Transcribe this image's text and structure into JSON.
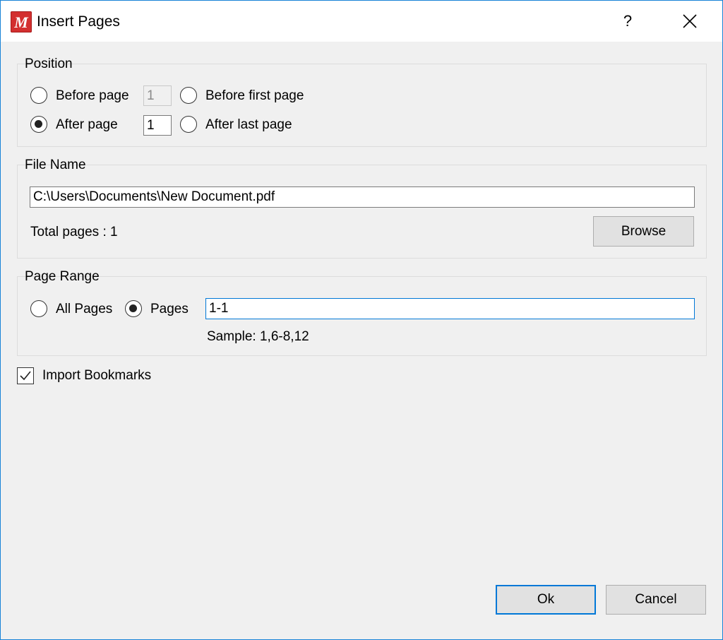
{
  "window": {
    "title": "Insert Pages",
    "help_label": "?",
    "app_icon_letter": "M"
  },
  "position": {
    "label": "Position",
    "before_page_label": "Before page",
    "before_page_value": "1",
    "before_first_label": "Before first page",
    "after_page_label": "After page",
    "after_page_value": "1",
    "after_last_label": "After last page",
    "selected": "after_page"
  },
  "file_name": {
    "label": "File Name",
    "path_value": "C:\\Users\\Documents\\New Document.pdf",
    "total_pages_text": "Total pages : 1",
    "browse_label": "Browse"
  },
  "page_range": {
    "label": "Page Range",
    "all_pages_label": "All Pages",
    "pages_label": "Pages",
    "pages_value": "1-1",
    "sample_text": "Sample: 1,6-8,12",
    "selected": "pages"
  },
  "import_bookmarks": {
    "label": "Import Bookmarks",
    "checked": true
  },
  "footer": {
    "ok_label": "Ok",
    "cancel_label": "Cancel"
  },
  "colors": {
    "accent": "#0078d7",
    "window_border": "#1883d7",
    "app_icon": "#d32f2f",
    "dialog_bg": "#f0f0f0"
  }
}
